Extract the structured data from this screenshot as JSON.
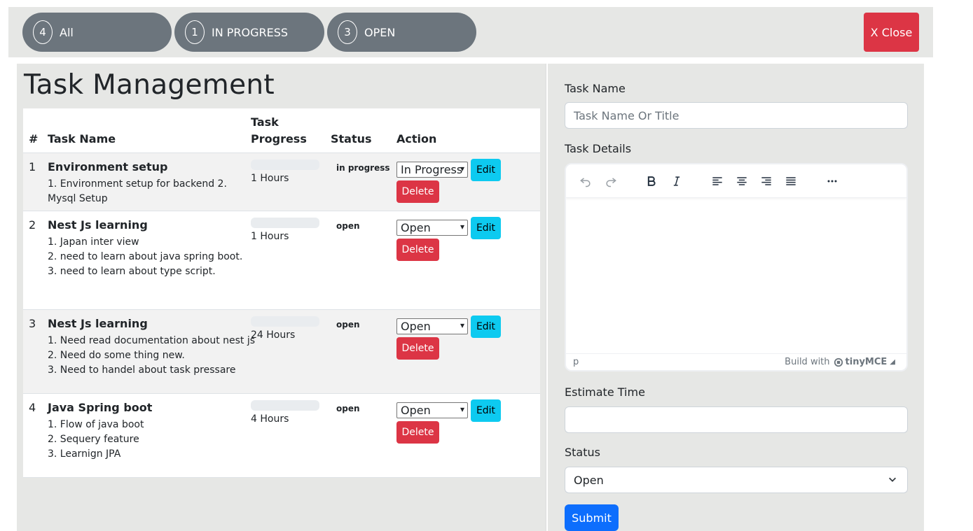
{
  "filters": [
    {
      "count": "4",
      "label": "All"
    },
    {
      "count": "1",
      "label": "IN PROGRESS"
    },
    {
      "count": "3",
      "label": "OPEN"
    }
  ],
  "close_label": "X Close",
  "title": "Task Management",
  "table": {
    "headers": {
      "num": "#",
      "name": "Task Name",
      "progress_1": "Task",
      "progress_2": "Progress",
      "status": "Status",
      "action": "Action"
    },
    "rows": [
      {
        "idx": "1",
        "name": "Environment setup",
        "details": [
          "1. Environment setup for backend 2. Mysql Setup"
        ],
        "progress": 0,
        "hours": "1 Hours",
        "status": "in progress",
        "select": "In Progress",
        "edit": "Edit",
        "delete": "Delete"
      },
      {
        "idx": "2",
        "name": "Nest Js learning",
        "details": [
          "1. Japan inter view",
          "2. need to learn about java spring boot.",
          "3. need to learn about type script."
        ],
        "progress": 0,
        "hours": "1 Hours",
        "status": "open",
        "select": "Open",
        "edit": "Edit",
        "delete": "Delete"
      },
      {
        "idx": "3",
        "name": "Nest Js learning",
        "details": [
          "1. Need read documentation about nest js",
          "2. Need do some thing new.",
          "3. Need to handel about task pressare"
        ],
        "progress": 0,
        "hours": "24 Hours",
        "status": "open",
        "select": "Open",
        "edit": "Edit",
        "delete": "Delete"
      },
      {
        "idx": "4",
        "name": "Java Spring boot",
        "details": [
          "1. Flow of java boot",
          "2. Sequery feature",
          "3. Learnign JPA"
        ],
        "progress": 0,
        "hours": "4 Hours",
        "status": "open",
        "select": "Open",
        "edit": "Edit",
        "delete": "Delete"
      }
    ]
  },
  "form": {
    "task_name_label": "Task Name",
    "task_name_placeholder": "Task Name Or Title",
    "task_details_label": "Task Details",
    "editor_tag": "p",
    "editor_brand_prefix": "Build with",
    "editor_brand": "tinyMCE",
    "estimate_label": "Estimate Time",
    "estimate_value": "",
    "status_label": "Status",
    "status_value": "Open",
    "submit_label": "Submit"
  },
  "toolbar_icons": [
    "undo-icon",
    "redo-icon",
    "bold-icon",
    "italic-icon",
    "align-left-icon",
    "align-center-icon",
    "align-right-icon",
    "align-justify-icon",
    "more-icon"
  ]
}
